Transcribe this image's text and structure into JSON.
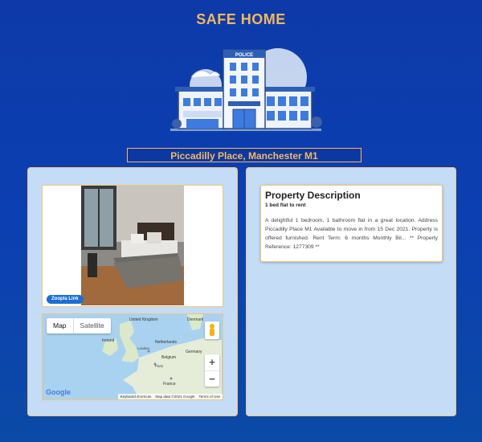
{
  "header": {
    "title": "SAFE HOME"
  },
  "hero": {
    "sign": "POLICE"
  },
  "listing": {
    "address": "Piccadilly Place, Manchester M1"
  },
  "photo": {
    "link_label": "Zoopla Link"
  },
  "map": {
    "tabs": [
      "Map",
      "Satellite"
    ],
    "labels": [
      "United Kingdom",
      "Ireland",
      "Denmark",
      "Netherlands",
      "London",
      "Belgium",
      "Germany",
      "Paris",
      "France"
    ],
    "provider": "Google",
    "attribution": [
      "Keyboard shortcuts",
      "Map data ©2021 Google",
      "Terms of Use"
    ]
  },
  "description": {
    "title": "Property Description",
    "subtitle": "1 bed flat to rent",
    "body": "A delightful 1 bedroom, 1 bathroom flat in a great location. Address Piccadilly Place M1 Available to move in from 15 Dec 2021. Property is offered furnished. Rent Term: 6 months Monthly Bil... ** Property Reference: 1277309 **"
  },
  "colors": {
    "accent": "#f5b95a",
    "panel": "#c4dcf6",
    "background": "#0d3aa8"
  }
}
